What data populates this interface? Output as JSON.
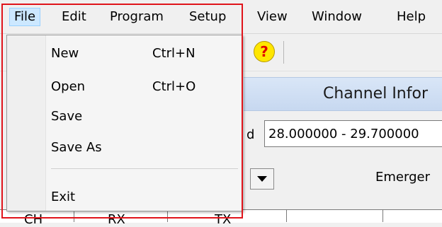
{
  "menubar": {
    "items": [
      {
        "label": "File",
        "active": true
      },
      {
        "label": "Edit"
      },
      {
        "label": "Program"
      },
      {
        "label": "Setup"
      },
      {
        "label": "View"
      },
      {
        "label": "Window"
      },
      {
        "label": "Help"
      }
    ]
  },
  "file_menu": {
    "items": [
      {
        "label": "New",
        "shortcut": "Ctrl+N"
      },
      {
        "label": "Open",
        "shortcut": "Ctrl+O"
      },
      {
        "label": "Save",
        "shortcut": ""
      },
      {
        "label": "Save As",
        "shortcut": ""
      },
      {
        "label": "Exit",
        "shortcut": ""
      }
    ]
  },
  "panel": {
    "title": "Channel Infor",
    "freq_label_partial": "d",
    "freq_value": "28.000000 - 29.700000",
    "emergency_partial": "Emerger"
  },
  "grid": {
    "headers_partial": [
      "CH",
      "RX",
      "TX"
    ]
  },
  "toolbar": {
    "help_icon": "help-icon",
    "help_glyph": "?"
  },
  "colors": {
    "highlight_border": "#e0141b",
    "menu_hover": "#cce8ff",
    "help_yellow": "#ffe600",
    "help_red": "#e10000"
  }
}
